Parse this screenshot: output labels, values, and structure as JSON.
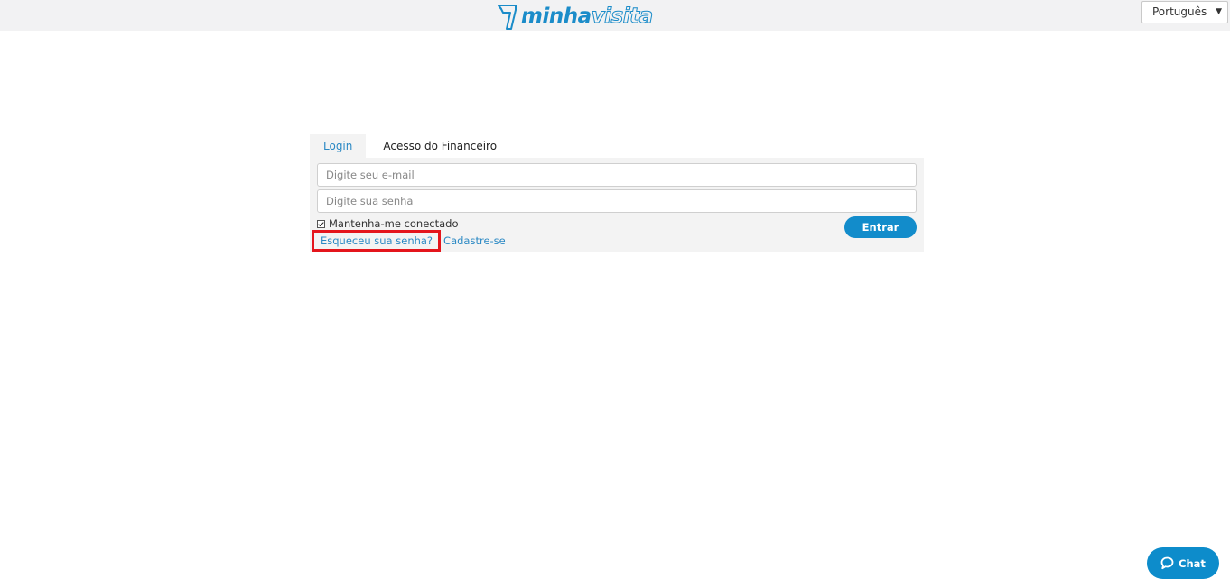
{
  "header": {
    "logo_bold": "minha",
    "logo_outline": "visita",
    "language_selected": "Português"
  },
  "login": {
    "tabs": [
      {
        "label": "Login",
        "active": true
      },
      {
        "label": "Acesso do Financeiro",
        "active": false
      }
    ],
    "email_placeholder": "Digite seu e-mail",
    "password_placeholder": "Digite sua senha",
    "remember_label": "Mantenha-me conectado",
    "remember_checked": true,
    "forgot_link": "Esqueceu sua senha?",
    "signup_link": "Cadastre-se",
    "submit_label": "Entrar"
  },
  "chat": {
    "label": "Chat",
    "icon": "chat-bubble-icon"
  },
  "colors": {
    "brand_blue": "#128ccb",
    "link_blue": "#2b89c4",
    "highlight_red": "#e4151c",
    "topbar_bg": "#f2f2f3",
    "panel_bg": "#f3f3f3"
  }
}
